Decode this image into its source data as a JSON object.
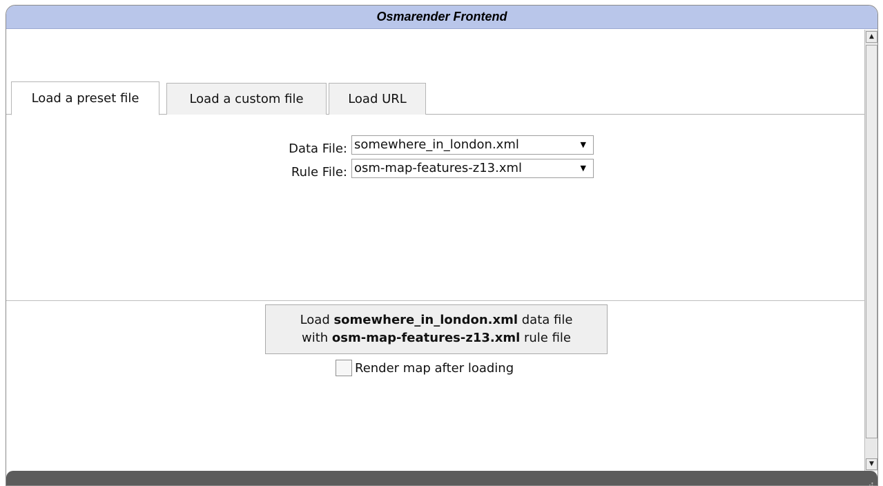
{
  "window": {
    "title": "Osmarender Frontend"
  },
  "tabs": [
    {
      "label": "Load a preset file",
      "active": true
    },
    {
      "label": "Load a custom file",
      "active": false
    },
    {
      "label": "Load URL",
      "active": false
    }
  ],
  "form": {
    "data_file_label": "Data File:",
    "data_file_value": "somewhere_in_london.xml",
    "rule_file_label": "Rule File:",
    "rule_file_value": "osm-map-features-z13.xml"
  },
  "load_button": {
    "line1_prefix": "Load ",
    "line1_bold": "somewhere_in_london.xml",
    "line1_suffix": " data file",
    "line2_prefix": "with ",
    "line2_bold": "osm-map-features-z13.xml",
    "line2_suffix": " rule file"
  },
  "render_option": {
    "label": "Render map after loading",
    "checked": false
  },
  "icons": {
    "scroll_up": "triangle-up",
    "scroll_down": "triangle-down",
    "select_arrow": "triangle-down",
    "resize_grip": "dots"
  },
  "colors": {
    "titlebar": "#b9c6ea",
    "statusbar": "#5c5c5c",
    "background": "#ffffff"
  }
}
